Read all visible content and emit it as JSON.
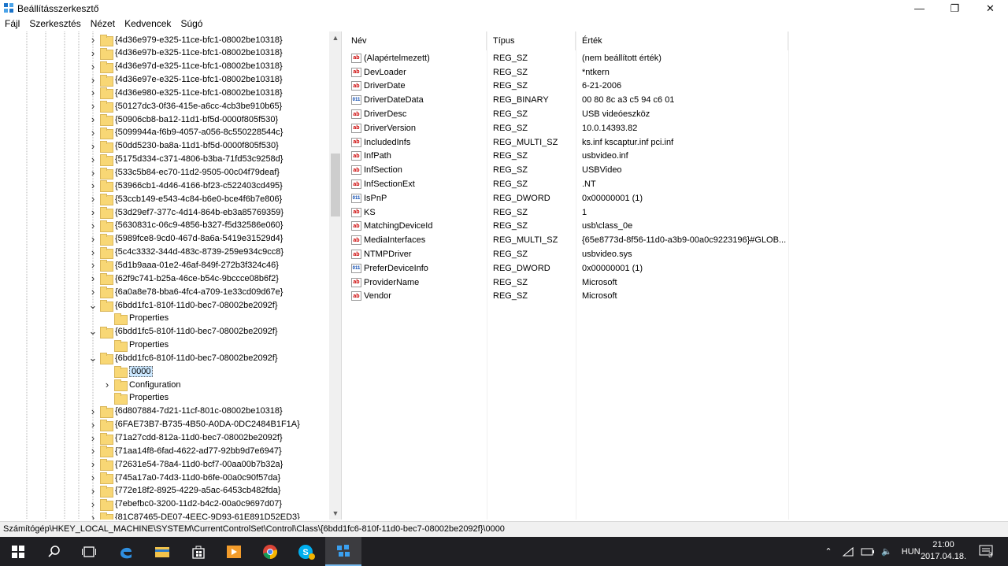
{
  "window": {
    "title": "Beállításszerkesztő",
    "minimize": "—",
    "maximize": "❐",
    "close": "✕"
  },
  "menu": [
    "Fájl",
    "Szerkesztés",
    "Nézet",
    "Kedvencek",
    "Súgó"
  ],
  "tree": [
    {
      "label": "{4d36e979-e325-11ce-bfc1-08002be10318}",
      "level": 0,
      "expander": "collapsed"
    },
    {
      "label": "{4d36e97b-e325-11ce-bfc1-08002be10318}",
      "level": 0,
      "expander": "collapsed"
    },
    {
      "label": "{4d36e97d-e325-11ce-bfc1-08002be10318}",
      "level": 0,
      "expander": "collapsed"
    },
    {
      "label": "{4d36e97e-e325-11ce-bfc1-08002be10318}",
      "level": 0,
      "expander": "collapsed"
    },
    {
      "label": "{4d36e980-e325-11ce-bfc1-08002be10318}",
      "level": 0,
      "expander": "collapsed"
    },
    {
      "label": "{50127dc3-0f36-415e-a6cc-4cb3be910b65}",
      "level": 0,
      "expander": "collapsed"
    },
    {
      "label": "{50906cb8-ba12-11d1-bf5d-0000f805f530}",
      "level": 0,
      "expander": "collapsed"
    },
    {
      "label": "{5099944a-f6b9-4057-a056-8c550228544c}",
      "level": 0,
      "expander": "collapsed"
    },
    {
      "label": "{50dd5230-ba8a-11d1-bf5d-0000f805f530}",
      "level": 0,
      "expander": "collapsed"
    },
    {
      "label": "{5175d334-c371-4806-b3ba-71fd53c9258d}",
      "level": 0,
      "expander": "collapsed"
    },
    {
      "label": "{533c5b84-ec70-11d2-9505-00c04f79deaf}",
      "level": 0,
      "expander": "collapsed"
    },
    {
      "label": "{53966cb1-4d46-4166-bf23-c522403cd495}",
      "level": 0,
      "expander": "collapsed"
    },
    {
      "label": "{53ccb149-e543-4c84-b6e0-bce4f6b7e806}",
      "level": 0,
      "expander": "collapsed"
    },
    {
      "label": "{53d29ef7-377c-4d14-864b-eb3a85769359}",
      "level": 0,
      "expander": "collapsed"
    },
    {
      "label": "{5630831c-06c9-4856-b327-f5d32586e060}",
      "level": 0,
      "expander": "collapsed"
    },
    {
      "label": "{5989fce8-9cd0-467d-8a6a-5419e31529d4}",
      "level": 0,
      "expander": "collapsed"
    },
    {
      "label": "{5c4c3332-344d-483c-8739-259e934c9cc8}",
      "level": 0,
      "expander": "collapsed"
    },
    {
      "label": "{5d1b9aaa-01e2-46af-849f-272b3f324c46}",
      "level": 0,
      "expander": "collapsed"
    },
    {
      "label": "{62f9c741-b25a-46ce-b54c-9bccce08b6f2}",
      "level": 0,
      "expander": "collapsed"
    },
    {
      "label": "{6a0a8e78-bba6-4fc4-a709-1e33cd09d67e}",
      "level": 0,
      "expander": "collapsed"
    },
    {
      "label": "{6bdd1fc1-810f-11d0-bec7-08002be2092f}",
      "level": 0,
      "expander": "expanded"
    },
    {
      "label": "Properties",
      "level": 1,
      "expander": "none"
    },
    {
      "label": "{6bdd1fc5-810f-11d0-bec7-08002be2092f}",
      "level": 0,
      "expander": "expanded"
    },
    {
      "label": "Properties",
      "level": 1,
      "expander": "none"
    },
    {
      "label": "{6bdd1fc6-810f-11d0-bec7-08002be2092f}",
      "level": 0,
      "expander": "expanded"
    },
    {
      "label": "0000",
      "level": 1,
      "expander": "none",
      "selected": true
    },
    {
      "label": "Configuration",
      "level": 1,
      "expander": "collapsed"
    },
    {
      "label": "Properties",
      "level": 1,
      "expander": "none"
    },
    {
      "label": "{6d807884-7d21-11cf-801c-08002be10318}",
      "level": 0,
      "expander": "collapsed"
    },
    {
      "label": "{6FAE73B7-B735-4B50-A0DA-0DC2484B1F1A}",
      "level": 0,
      "expander": "collapsed"
    },
    {
      "label": "{71a27cdd-812a-11d0-bec7-08002be2092f}",
      "level": 0,
      "expander": "collapsed"
    },
    {
      "label": "{71aa14f8-6fad-4622-ad77-92bb9d7e6947}",
      "level": 0,
      "expander": "collapsed"
    },
    {
      "label": "{72631e54-78a4-11d0-bcf7-00aa00b7b32a}",
      "level": 0,
      "expander": "collapsed"
    },
    {
      "label": "{745a17a0-74d3-11d0-b6fe-00a0c90f57da}",
      "level": 0,
      "expander": "collapsed"
    },
    {
      "label": "{772e18f2-8925-4229-a5ac-6453cb482fda}",
      "level": 0,
      "expander": "collapsed"
    },
    {
      "label": "{7ebefbc0-3200-11d2-b4c2-00a0c9697d07}",
      "level": 0,
      "expander": "collapsed"
    },
    {
      "label": "{81C87465-DE07-4EEC-9D93-61E891D52ED3}",
      "level": 0,
      "expander": "collapsed"
    }
  ],
  "list": {
    "headers": {
      "name": "Név",
      "type": "Típus",
      "data": "Érték"
    },
    "rows": [
      {
        "icon": "string-value-icon",
        "name": "(Alapértelmezett)",
        "type": "REG_SZ",
        "data": "(nem beállított érték)"
      },
      {
        "icon": "string-value-icon",
        "name": "DevLoader",
        "type": "REG_SZ",
        "data": "*ntkern"
      },
      {
        "icon": "string-value-icon",
        "name": "DriverDate",
        "type": "REG_SZ",
        "data": "6-21-2006"
      },
      {
        "icon": "binary-value-icon",
        "name": "DriverDateData",
        "type": "REG_BINARY",
        "data": "00 80 8c a3 c5 94 c6 01"
      },
      {
        "icon": "string-value-icon",
        "name": "DriverDesc",
        "type": "REG_SZ",
        "data": "USB videóeszköz"
      },
      {
        "icon": "string-value-icon",
        "name": "DriverVersion",
        "type": "REG_SZ",
        "data": "10.0.14393.82"
      },
      {
        "icon": "string-value-icon",
        "name": "IncludedInfs",
        "type": "REG_MULTI_SZ",
        "data": "ks.inf kscaptur.inf pci.inf"
      },
      {
        "icon": "string-value-icon",
        "name": "InfPath",
        "type": "REG_SZ",
        "data": "usbvideo.inf"
      },
      {
        "icon": "string-value-icon",
        "name": "InfSection",
        "type": "REG_SZ",
        "data": "USBVideo"
      },
      {
        "icon": "string-value-icon",
        "name": "InfSectionExt",
        "type": "REG_SZ",
        "data": ".NT"
      },
      {
        "icon": "binary-value-icon",
        "name": "IsPnP",
        "type": "REG_DWORD",
        "data": "0x00000001 (1)"
      },
      {
        "icon": "string-value-icon",
        "name": "KS",
        "type": "REG_SZ",
        "data": "1"
      },
      {
        "icon": "string-value-icon",
        "name": "MatchingDeviceId",
        "type": "REG_SZ",
        "data": "usb\\class_0e"
      },
      {
        "icon": "string-value-icon",
        "name": "MediaInterfaces",
        "type": "REG_MULTI_SZ",
        "data": "{65e8773d-8f56-11d0-a3b9-00a0c9223196}#GLOB..."
      },
      {
        "icon": "string-value-icon",
        "name": "NTMPDriver",
        "type": "REG_SZ",
        "data": "usbvideo.sys"
      },
      {
        "icon": "binary-value-icon",
        "name": "PreferDeviceInfo",
        "type": "REG_DWORD",
        "data": "0x00000001 (1)"
      },
      {
        "icon": "string-value-icon",
        "name": "ProviderName",
        "type": "REG_SZ",
        "data": "Microsoft"
      },
      {
        "icon": "string-value-icon",
        "name": "Vendor",
        "type": "REG_SZ",
        "data": "Microsoft"
      }
    ]
  },
  "statusbar": {
    "path": "Számítógép\\HKEY_LOCAL_MACHINE\\SYSTEM\\CurrentControlSet\\Control\\Class\\{6bdd1fc6-810f-11d0-bec7-08002be2092f}\\0000"
  },
  "taskbar": {
    "buttons": [
      "start-icon",
      "search-icon",
      "task-view-icon",
      "edge-icon",
      "file-explorer-icon",
      "store-icon",
      "media-player-icon",
      "chrome-icon",
      "skype-icon",
      "regedit-icon"
    ],
    "language": "HUN",
    "time": "21:00",
    "date": "2017.04.18.",
    "notifications_count": "3"
  },
  "colors": {
    "accent": "#0078d7",
    "selection": "#cce8ff",
    "taskbar": "#1f1f23",
    "folder": "#f8d775"
  }
}
